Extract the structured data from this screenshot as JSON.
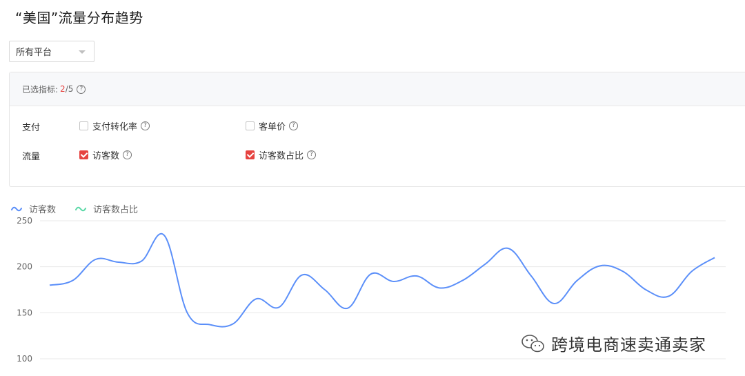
{
  "page": {
    "title": "“美国”流量分布趋势"
  },
  "platform_filter": {
    "selected": "所有平台"
  },
  "metrics_panel": {
    "selected_label": "已选指标:",
    "selected_count": "2",
    "selected_total": "/5",
    "groups": [
      {
        "label": "支付",
        "metrics": [
          {
            "label": "支付转化率",
            "checked": false
          },
          {
            "label": "客单价",
            "checked": false
          }
        ]
      },
      {
        "label": "流量",
        "metrics": [
          {
            "label": "访客数",
            "checked": true
          },
          {
            "label": "访客数占比",
            "checked": true
          }
        ]
      }
    ]
  },
  "watermark": {
    "text": "跨境电商速卖通卖家"
  },
  "colors": {
    "accent_red": "#e64340",
    "series_visitors": "#5b8ff9",
    "series_share": "#5ad8a6"
  },
  "chart_data": {
    "type": "line",
    "legend_position": "top-left",
    "grid": true,
    "ylim": [
      100,
      250
    ],
    "yticks": [
      "100",
      "150",
      "200",
      "250"
    ],
    "series": [
      {
        "name": "访客数",
        "values": [
          180,
          185,
          208,
          205,
          206,
          234,
          150,
          137,
          138,
          165,
          156,
          191,
          175,
          155,
          192,
          184,
          190,
          177,
          185,
          203,
          220,
          190,
          160,
          185,
          201,
          195,
          175,
          168,
          195,
          210
        ]
      },
      {
        "name": "访客数占比",
        "values": []
      }
    ]
  }
}
